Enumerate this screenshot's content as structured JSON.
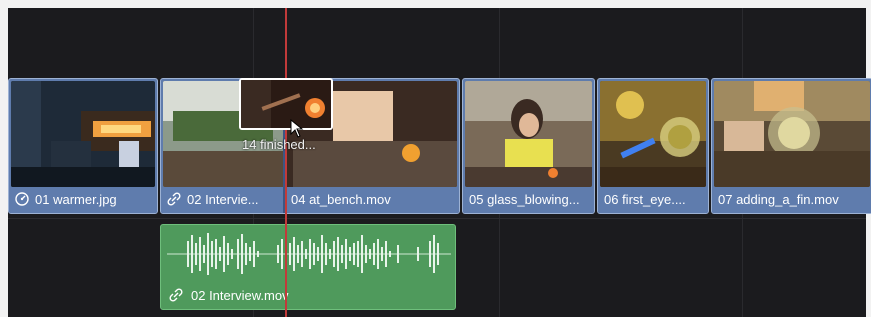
{
  "timeline": {
    "video_clips": [
      {
        "name": "01 warmer.jpg",
        "icon": "speed-icon"
      },
      {
        "name": "02 Intervie...",
        "icon": "link-icon"
      },
      {
        "name": "04 at_bench.mov",
        "icon": ""
      },
      {
        "name": "05 glass_blowing...",
        "icon": ""
      },
      {
        "name": "06 first_eye....",
        "icon": ""
      },
      {
        "name": "07 adding_a_fin.mov",
        "icon": ""
      }
    ],
    "audio_clip": {
      "name": "02 Interview.mov",
      "icon": "link-icon"
    },
    "drag_status": "14 finished..."
  },
  "colors": {
    "background": "#1b1b1e",
    "video_clip": "#5f7cad",
    "audio_clip": "#4f9a5c",
    "playhead": "#c23a3a"
  }
}
